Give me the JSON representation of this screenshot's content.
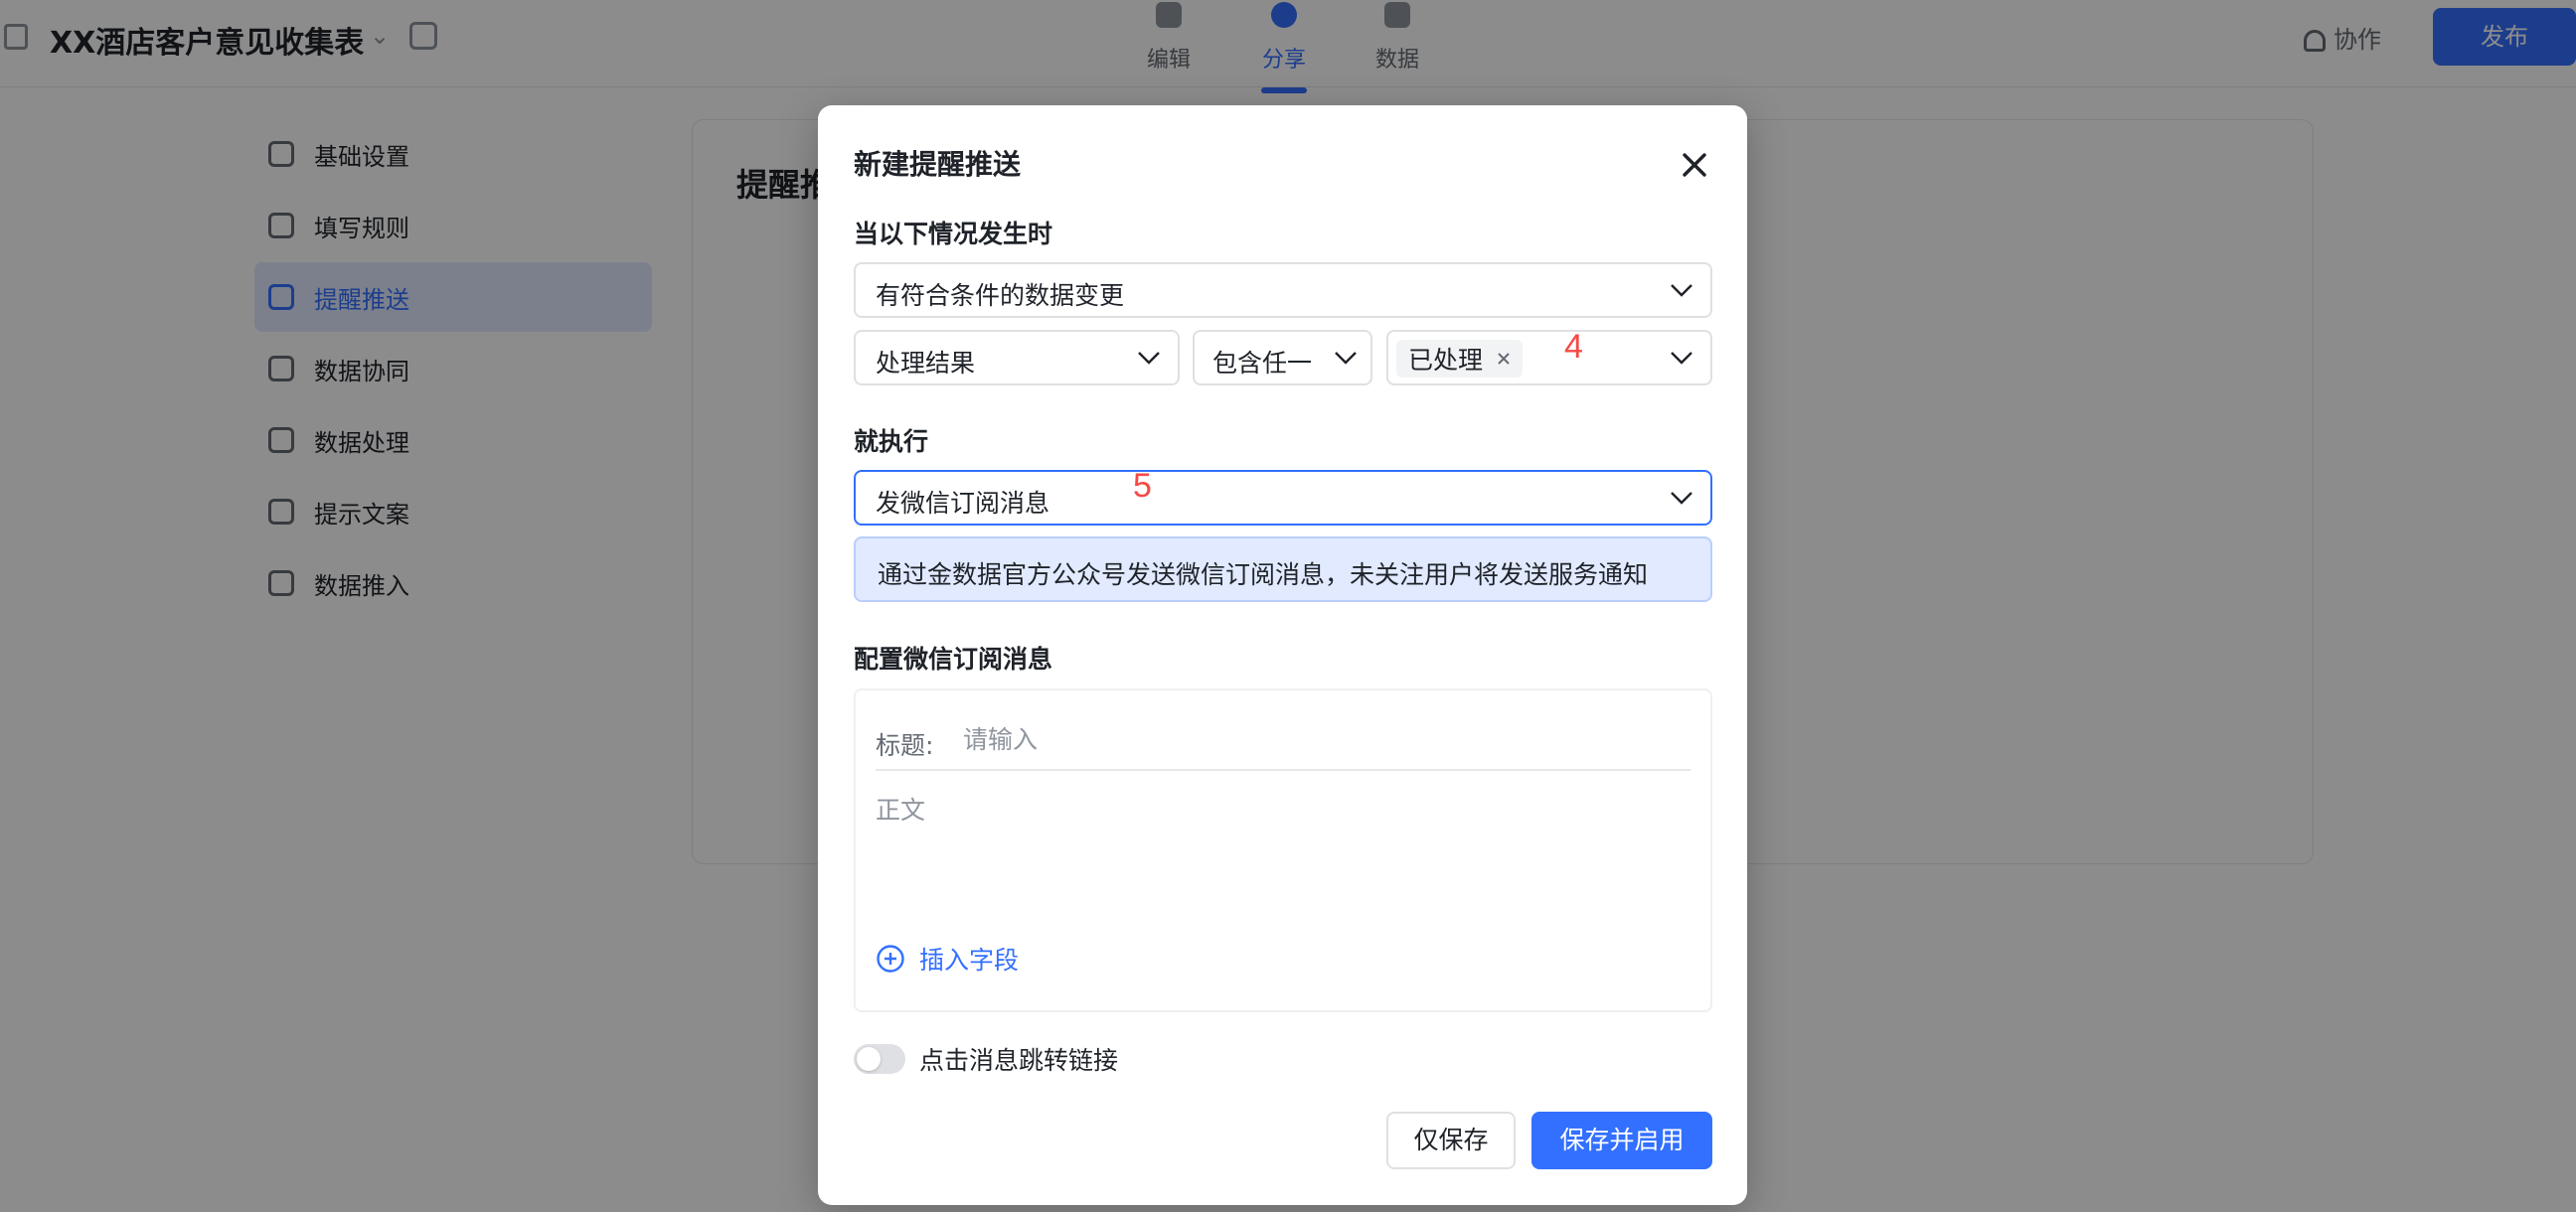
{
  "app": {
    "title": "XX酒店客户意见收集表",
    "top_tabs": [
      {
        "label": "编辑",
        "icon": "edit-icon"
      },
      {
        "label": "分享",
        "icon": "share-icon"
      },
      {
        "label": "数据",
        "icon": "data-icon"
      }
    ],
    "share_label": "协作",
    "publish_label": "发布"
  },
  "sidebar": {
    "items": [
      {
        "label": "基础设置",
        "icon": "settings-icon"
      },
      {
        "label": "填写规则",
        "icon": "rule-icon"
      },
      {
        "label": "提醒推送",
        "icon": "push-icon"
      },
      {
        "label": "数据协同",
        "icon": "sync-icon"
      },
      {
        "label": "数据处理",
        "icon": "process-icon"
      },
      {
        "label": "提示文案",
        "icon": "text-icon"
      },
      {
        "label": "数据推入",
        "icon": "import-icon"
      }
    ]
  },
  "content": {
    "title": "提醒推送"
  },
  "modal": {
    "title": "新建提醒推送",
    "trigger": {
      "label": "当以下情况发生时",
      "event": "有符合条件的数据变更",
      "field": "处理结果",
      "operator": "包含任一",
      "value_tag": "已处理"
    },
    "action": {
      "label": "就执行",
      "selected": "发微信订阅消息",
      "info": "通过金数据官方公众号发送微信订阅消息，未关注用户将发送服务通知"
    },
    "config": {
      "label": "配置微信订阅消息",
      "title_label": "标题:",
      "title_placeholder": "请输入",
      "body_placeholder": "正文",
      "insert_label": "插入字段"
    },
    "toggle": {
      "label": "点击消息跳转链接",
      "on": false
    },
    "buttons": {
      "save_only": "仅保存",
      "save_enable": "保存并启用"
    },
    "annotations": [
      "4",
      "5"
    ]
  },
  "colors": {
    "primary": "#3370ff",
    "annotation": "#f54a45",
    "info_bg": "#e1eaff"
  }
}
